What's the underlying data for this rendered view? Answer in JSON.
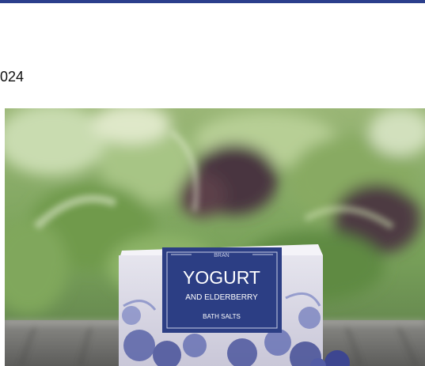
{
  "header": {
    "accent_color": "#2b3f8c"
  },
  "article": {
    "date_fragment": "024"
  },
  "product_image": {
    "brand": "BRAN",
    "name_line1": "YOGURT",
    "name_line2": "AND ELDERBERRY",
    "product_type": "BATH SALTS",
    "label_color": "#2c3e84"
  }
}
